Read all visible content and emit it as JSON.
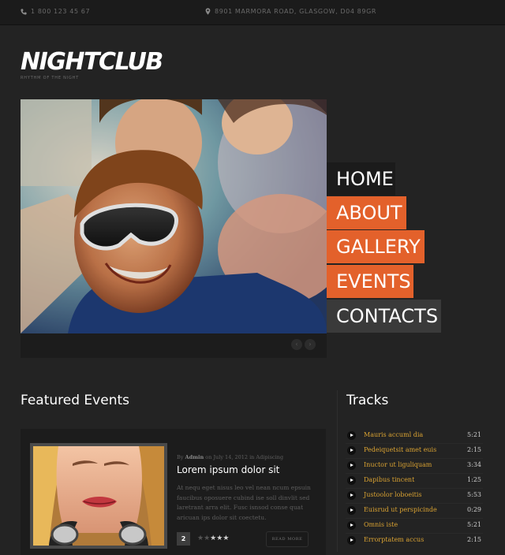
{
  "topbar": {
    "phone": "1 800 123 45 67",
    "address": "8901 MARMORA ROAD, GLASGOW, D04 89GR",
    "phone_icon": "phone-icon",
    "address_icon": "location-pin-icon"
  },
  "logo": {
    "title": "NIGHTCLUB",
    "tagline": "RHYTHM OF THE NIGHT"
  },
  "menu": [
    {
      "label": "HOME",
      "color": "#1b1b1b"
    },
    {
      "label": "ABOUT",
      "color": "#e3612b"
    },
    {
      "label": "GALLERY",
      "color": "#e3612b"
    },
    {
      "label": "EVENTS",
      "color": "#e3612b"
    },
    {
      "label": "CONTACTS",
      "color": "#3a3a3a"
    }
  ],
  "slider": {
    "prev_icon": "chevron-left-icon",
    "next_icon": "chevron-right-icon",
    "prev_label": "‹",
    "next_label": "›"
  },
  "featured": {
    "heading": "Featured Events",
    "post": {
      "meta_by": "By",
      "author": "Admin",
      "meta_date": "on July 14, 2012 in Adipiscing",
      "title": "Lorem ipsum dolor sit",
      "text": "At nequ eget nisus leo vel nean ncum epsuin faucibus oposuere cubind ise soll dinvlit sed laretrant arra elit. Fusc isnsod conse quat aricuan ips dolor sit coectetu.",
      "comments": "2",
      "rating": 3,
      "rating_max": 5,
      "read_more": "READ MORE"
    }
  },
  "tracks": {
    "heading": "Tracks",
    "items": [
      {
        "name": "Mauris accuml dia",
        "time": "5:21"
      },
      {
        "name": "Pedeiquetsit amet euis",
        "time": "2:15"
      },
      {
        "name": "Inuctor ut liguliquam",
        "time": "3:34"
      },
      {
        "name": "Dapibus tincent",
        "time": "1:25"
      },
      {
        "name": "Justoolor loboeitis",
        "time": "5:53"
      },
      {
        "name": "Euisrud ut perspicinde",
        "time": "0:29"
      },
      {
        "name": "Omnis iste",
        "time": "5:21"
      },
      {
        "name": "Errorptatem accus",
        "time": "2:15"
      }
    ]
  },
  "colors": {
    "accent": "#e3612b",
    "track_name": "#d9a232",
    "background": "#232323"
  }
}
